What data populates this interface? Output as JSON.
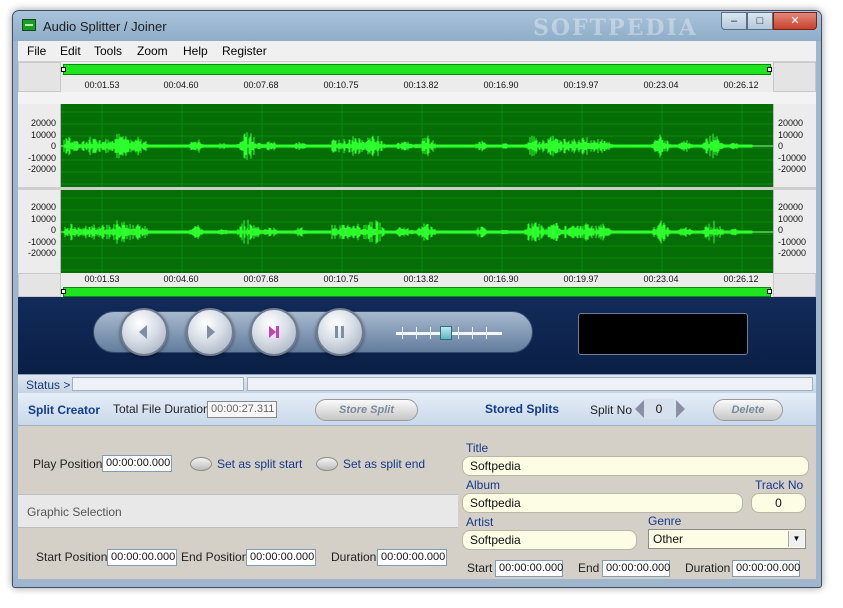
{
  "window": {
    "title": "Audio Splitter / Joiner",
    "watermark": "SOFTPEDIA"
  },
  "window_controls": {
    "minimize": "–",
    "maximize": "□",
    "close": "✕"
  },
  "menu": [
    "File",
    "Edit",
    "Tools",
    "Zoom",
    "Help",
    "Register"
  ],
  "timeline": {
    "ticks": [
      "00:01.53",
      "00:04.60",
      "00:07.68",
      "00:10.75",
      "00:13.82",
      "00:16.90",
      "00:19.97",
      "00:23.04",
      "00:26.12"
    ]
  },
  "amplitude_labels": [
    "20000",
    "10000",
    "0",
    "-10000",
    "-20000"
  ],
  "status": {
    "label": "Status >",
    "text": ""
  },
  "split_creator": {
    "title": "Split Creator",
    "total_label": "Total File Duration",
    "total_value": "00:00:27.311",
    "store_button": "Store Split",
    "play_label": "Play Position",
    "play_value": "00:00:00.000",
    "set_start": "Set as split start",
    "set_end": "Set as split end",
    "graphic_selection": "Graphic Selection",
    "start_label": "Start Position",
    "start_value": "00:00:00.000",
    "end_label": "End Position",
    "end_value": "00:00:00.000",
    "duration_label": "Duration",
    "duration_value": "00:00:00.000"
  },
  "stored_splits": {
    "title": "Stored Splits",
    "split_no_label": "Split No",
    "split_no_value": "0",
    "delete_button": "Delete",
    "title_label": "Title",
    "title_value": "Softpedia",
    "album_label": "Album",
    "album_value": "Softpedia",
    "track_label": "Track No",
    "track_value": "0",
    "artist_label": "Artist",
    "artist_value": "Softpedia",
    "genre_label": "Genre",
    "genre_value": "Other",
    "start_label": "Start",
    "start_value": "00:00:00.000",
    "end_label": "End",
    "end_value": "00:00:00.000",
    "duration_label": "Duration",
    "duration_value": "00:00:00.000"
  },
  "colors": {
    "waveform_bg": "#066e06",
    "waveform_line": "#2cff2c",
    "selection_bar": "#1ee51e",
    "transport_bg": "#0f2650"
  },
  "icons": [
    "app-icon",
    "previous-icon",
    "play-icon",
    "next-icon",
    "pause-icon"
  ]
}
